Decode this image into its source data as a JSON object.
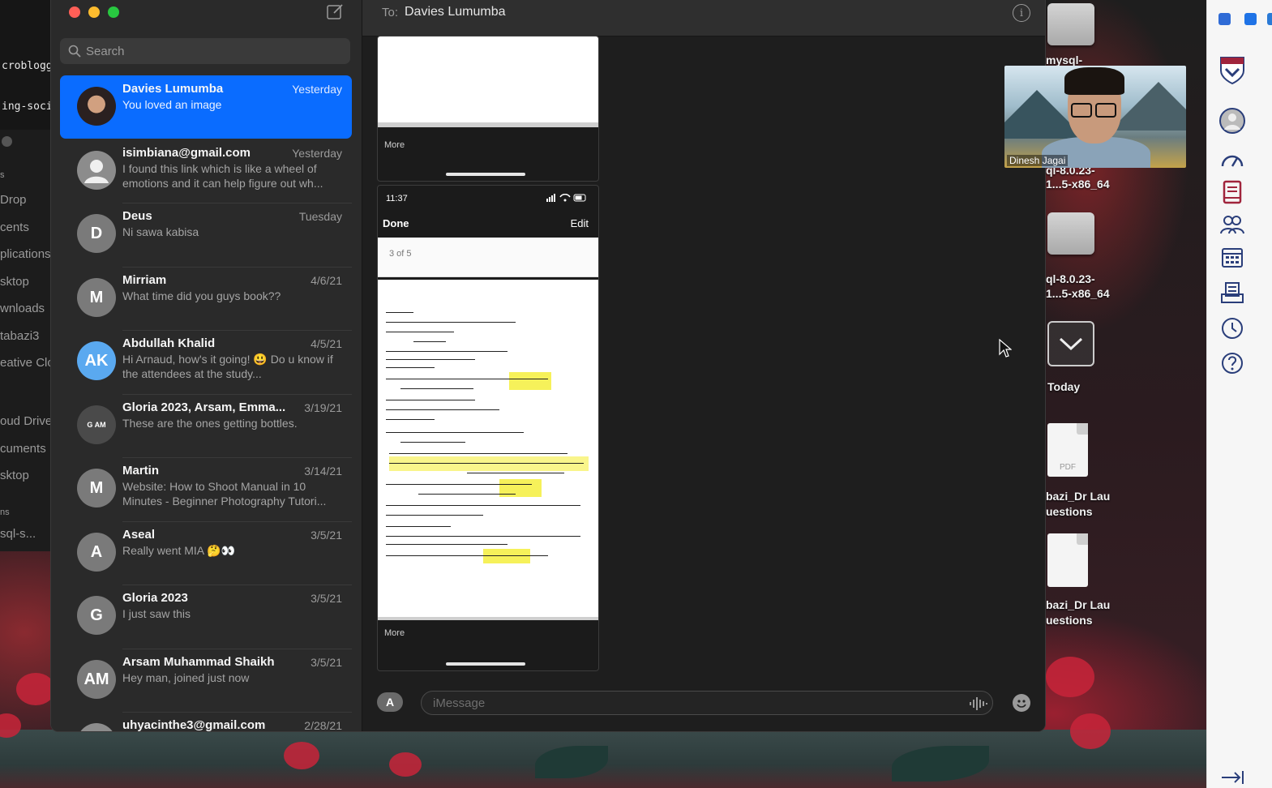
{
  "terminal": {
    "lines": [
      "crobloggi",
      "ing-socia"
    ]
  },
  "finder": {
    "items": [
      "s",
      "Drop",
      "cents",
      "plications",
      "sktop",
      "wnloads",
      "tabazi3",
      "eative Clo",
      "oud Drive",
      "cuments",
      "sktop",
      "ns",
      "sql-s..."
    ]
  },
  "messages": {
    "search_placeholder": "Search",
    "conversations": [
      {
        "name": "Davies Lumumba",
        "date": "Yesterday",
        "preview": "You loved an image",
        "initials": "",
        "selected": true
      },
      {
        "name": "isimbiana@gmail.com",
        "date": "Yesterday",
        "preview": "I found this link which is like a wheel of emotions and it can help figure out wh...",
        "initials": ""
      },
      {
        "name": "Deus",
        "date": "Tuesday",
        "preview": "Ni sawa kabisa",
        "initials": "D"
      },
      {
        "name": "Mirriam",
        "date": "4/6/21",
        "preview": "What time did you guys book??",
        "initials": "M"
      },
      {
        "name": "Abdullah Khalid",
        "date": "4/5/21",
        "preview": "Hi Arnaud, how's it going! 😃 Do u know if the attendees at the study...",
        "initials": "AK"
      },
      {
        "name": "Gloria 2023, Arsam, Emma...",
        "date": "3/19/21",
        "preview": "These are the ones getting bottles.",
        "initials": "G AM"
      },
      {
        "name": "Martin",
        "date": "3/14/21",
        "preview": "Website: How to Shoot Manual in 10 Minutes - Beginner Photography Tutori...",
        "initials": "M"
      },
      {
        "name": "Aseal",
        "date": "3/5/21",
        "preview": "Really went MIA 🤔👀",
        "initials": "A"
      },
      {
        "name": "Gloria 2023",
        "date": "3/5/21",
        "preview": "I just saw this",
        "initials": "G"
      },
      {
        "name": "Arsam Muhammad Shaikh",
        "date": "3/5/21",
        "preview": "Hey man, joined just now",
        "initials": "AM"
      },
      {
        "name": "uhyacinthe3@gmail.com",
        "date": "2/28/21",
        "preview": "",
        "initials": ""
      }
    ],
    "chat": {
      "to_label": "To:",
      "recipient": "Davies Lumumba",
      "info_icon": "i",
      "shot1_more": "More",
      "shot2": {
        "time": "11:37",
        "done": "Done",
        "edit": "Edit",
        "page": "3 of 5",
        "more": "More"
      },
      "input_placeholder": "iMessage"
    }
  },
  "desktop_icons": {
    "labels": [
      "mysql-",
      "ql-8.0.23-",
      "1...5-x86_64",
      "ql-8.0.23-",
      "1...5-x86_64",
      "Today",
      "bazi_Dr Lau",
      "uestions",
      "bazi_Dr Lau",
      "uestions"
    ],
    "pdf_label": "PDF"
  },
  "video": {
    "participant": "Dinesh Jagai"
  },
  "colors": {
    "selected": "#0a6cff",
    "toolbar_accent": "#a0243c"
  }
}
